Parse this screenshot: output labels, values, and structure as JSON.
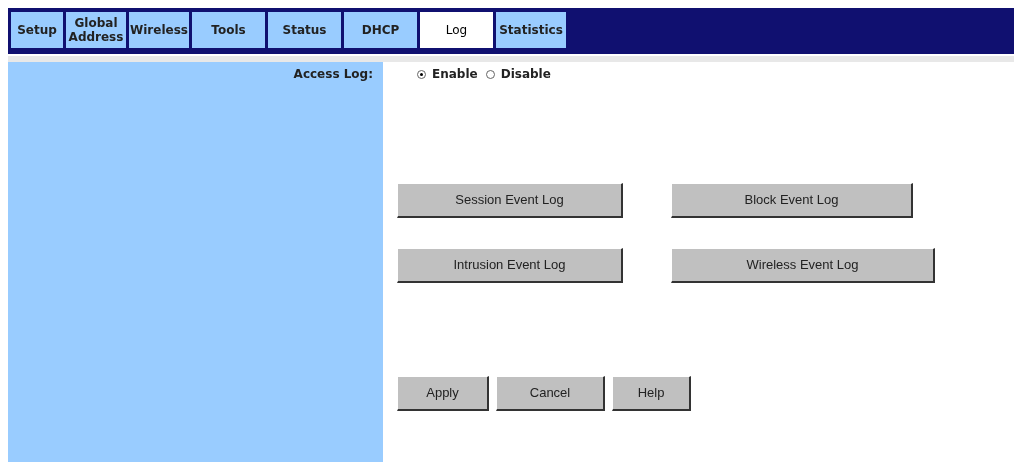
{
  "tabs": [
    {
      "label": "Setup",
      "selected": false
    },
    {
      "label": "Global Address",
      "selected": false
    },
    {
      "label": "Wireless",
      "selected": false
    },
    {
      "label": "Tools",
      "selected": false
    },
    {
      "label": "Status",
      "selected": false
    },
    {
      "label": "DHCP",
      "selected": false
    },
    {
      "label": "Log",
      "selected": true
    },
    {
      "label": "Statistics",
      "selected": false
    }
  ],
  "access_log": {
    "label": "Access Log:",
    "options": [
      {
        "label": "Enable",
        "selected": true
      },
      {
        "label": "Disable",
        "selected": false
      }
    ]
  },
  "log_buttons": [
    [
      "Session Event Log",
      "Block Event Log"
    ],
    [
      "Intrusion Event Log",
      "Wireless Event Log"
    ]
  ],
  "actions": [
    "Apply",
    "Cancel",
    "Help"
  ]
}
